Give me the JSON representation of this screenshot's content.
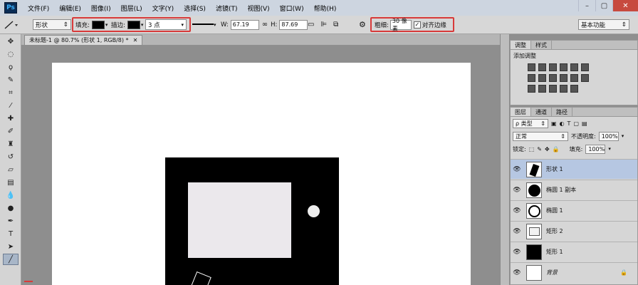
{
  "app": {
    "logo": "Ps"
  },
  "menu": [
    "文件(F)",
    "编辑(E)",
    "图像(I)",
    "图层(L)",
    "文字(Y)",
    "选择(S)",
    "滤镜(T)",
    "视图(V)",
    "窗口(W)",
    "帮助(H)"
  ],
  "window_controls": [
    "–",
    "▢",
    "✕"
  ],
  "options": {
    "mode": "形状",
    "fill_label": "填充:",
    "stroke_label": "描边:",
    "stroke_width": "3 点",
    "w_label": "W:",
    "w_value": "67.19",
    "h_label": "H:",
    "h_value": "87.69",
    "weight_label": "粗细:",
    "weight_value": "30 像素",
    "align_edges_label": "对齐边缘",
    "align_edges_checked": true,
    "workspace": "基本功能"
  },
  "document_tab": {
    "title": "未标题-1 @ 80.7% (形状 1, RGB/8) *"
  },
  "adjustments": {
    "tabs": [
      "调整",
      "样式"
    ],
    "title": "添加调整"
  },
  "layers": {
    "tabs": [
      "图层",
      "通道",
      "路径"
    ],
    "filter": "ρ 类型",
    "blend_mode": "正常",
    "opacity_label": "不透明度:",
    "opacity_value": "100%",
    "lock_label": "锁定:",
    "fill_label": "填充:",
    "fill_value": "100%",
    "items": [
      {
        "name": "形状 1",
        "selected": true
      },
      {
        "name": "椭圆 1 副本",
        "selected": false
      },
      {
        "name": "椭圆 1",
        "selected": false
      },
      {
        "name": "矩形 2",
        "selected": false
      },
      {
        "name": "矩形 1",
        "selected": false
      },
      {
        "name": "背景",
        "selected": false
      }
    ]
  },
  "colors": {
    "highlight_red": "#d83a3a",
    "selected_layer": "#b6c7e2"
  }
}
